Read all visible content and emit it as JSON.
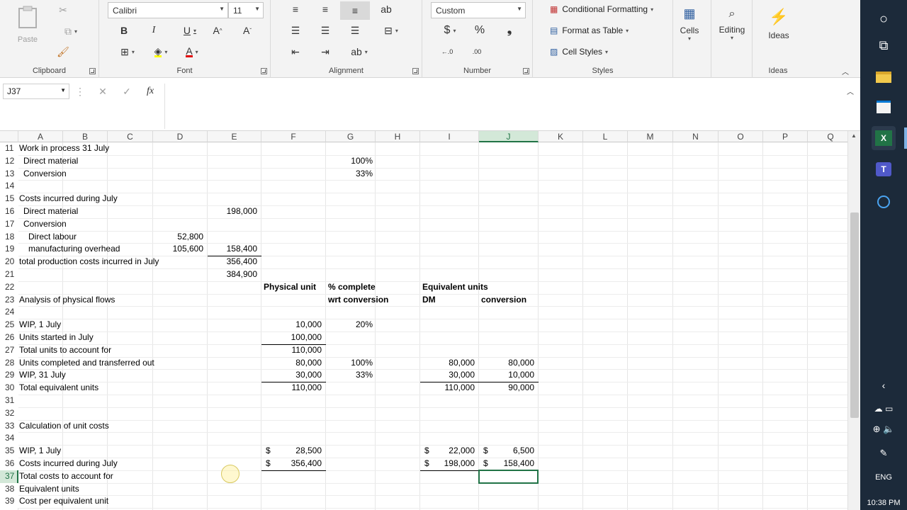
{
  "ribbon": {
    "clipboard": {
      "paste": "Paste",
      "label": "Clipboard"
    },
    "font": {
      "name": "Calibri",
      "size": "11",
      "label": "Font"
    },
    "alignment": {
      "label": "Alignment"
    },
    "number": {
      "format": "Custom",
      "label": "Number",
      "currency": "$",
      "percent": "%",
      "comma": "❟"
    },
    "styles": {
      "conditional": "Conditional Formatting",
      "format_table": "Format as Table",
      "cell_styles": "Cell Styles",
      "label": "Styles"
    },
    "cells": {
      "label": "Cells"
    },
    "editing": {
      "label": "Editing"
    },
    "ideas": {
      "button": "Ideas",
      "label": "Ideas"
    }
  },
  "formula_bar": {
    "name_box": "J37",
    "cancel": "✕",
    "enter": "✓",
    "fx": "fx",
    "value": ""
  },
  "columns": [
    "A",
    "B",
    "C",
    "D",
    "E",
    "F",
    "G",
    "H",
    "I",
    "J",
    "K",
    "L",
    "M",
    "N",
    "O",
    "P",
    "Q"
  ],
  "selected_column": "J",
  "rows": [
    "11",
    "12",
    "13",
    "14",
    "15",
    "16",
    "17",
    "18",
    "19",
    "20",
    "21",
    "22",
    "23",
    "24",
    "25",
    "26",
    "27",
    "28",
    "29",
    "30",
    "31",
    "32",
    "33",
    "34",
    "35",
    "36",
    "37",
    "38",
    "39"
  ],
  "selected_row": "37",
  "cells": {
    "A11": "Work in process 31 July",
    "A12": "Direct material",
    "G12": "100%",
    "A13": "Conversion",
    "G13": "33%",
    "A15": "Costs incurred during July",
    "A16": "Direct material",
    "E16": "198,000",
    "A17": "Conversion",
    "A18": "Direct labour",
    "D18": "52,800",
    "A19": "manufacturing overhead",
    "D19": "105,600",
    "E19": "158,400",
    "A20": "total production costs incurred in July",
    "E20": "356,400",
    "E21": "384,900",
    "F22": "Physical unit",
    "G22": "% complete",
    "I22": "Equivalent units",
    "A23": "Analysis of physical flows",
    "G23": "wrt conversion",
    "I23": "DM",
    "J23": "conversion",
    "A25": "WIP, 1 July",
    "F25": "10,000",
    "G25": "20%",
    "A26": "Units started in July",
    "F26": "100,000",
    "A27": "Total units to account for",
    "F27": "110,000",
    "A28": "Units completed and transferred out",
    "F28": "80,000",
    "G28": "100%",
    "I28": "80,000",
    "J28": "80,000",
    "A29": "WIP, 31 July",
    "F29": "30,000",
    "G29": "33%",
    "I29": "30,000",
    "J29": "10,000",
    "A30": "Total equivalent units",
    "F30": "110,000",
    "I30": "110,000",
    "J30": "90,000",
    "A33": "Calculation of unit costs",
    "A35": "WIP, 1 July",
    "F35_sym": "$",
    "F35": "28,500",
    "I35_sym": "$",
    "I35": "22,000",
    "J35_sym": "$",
    "J35": "6,500",
    "A36": "Costs incurred during July",
    "F36_sym": "$",
    "F36": "356,400",
    "I36_sym": "$",
    "I36": "198,000",
    "J36_sym": "$",
    "J36": "158,400",
    "A37": "Total costs to account for",
    "A38": "Equivalent units",
    "A39": "Cost per equivalent unit"
  },
  "taskbar": {
    "lang": "ENG",
    "time": "10:38 PM"
  }
}
